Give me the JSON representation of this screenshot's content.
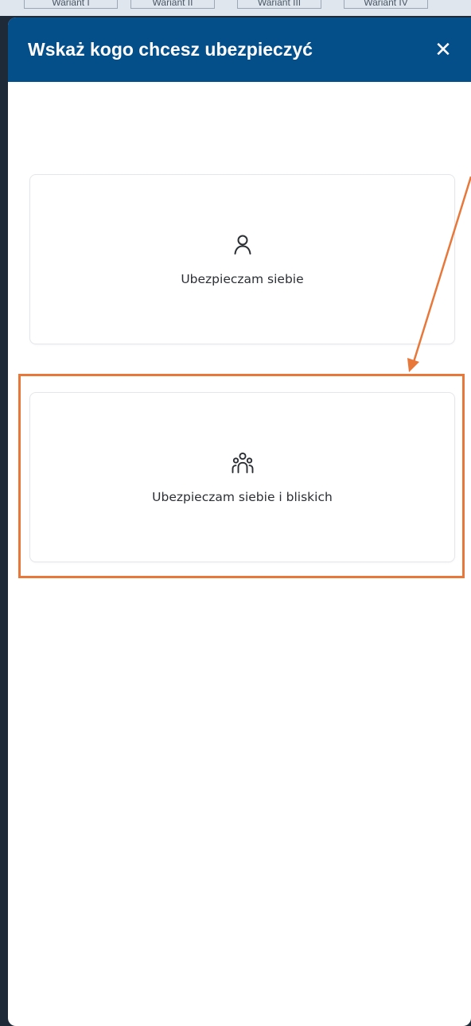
{
  "background_tabs": [
    "Wariant I",
    "Wariant II",
    "Wariant III",
    "Wariant IV"
  ],
  "modal": {
    "title": "Wskaż kogo chcesz ubezpieczyć",
    "close_glyph": "✕",
    "header_color": "#044f8a"
  },
  "options": [
    {
      "label": "Ubezpieczam siebie",
      "icon": "person-icon"
    },
    {
      "label": "Ubezpieczam siebie i bliskich",
      "icon": "group-icon"
    }
  ],
  "annotation": {
    "color": "#e8773a",
    "target": "options.1"
  }
}
